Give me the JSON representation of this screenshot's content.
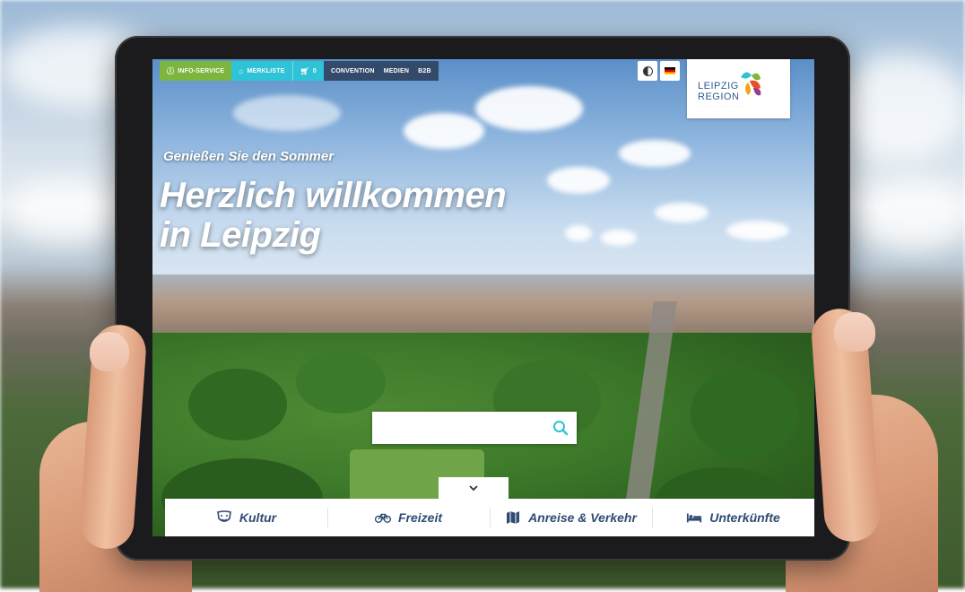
{
  "topnav": {
    "info_service": "INFO-SERVICE",
    "merkliste": "MERKLISTE",
    "cart_count": "0",
    "convention": "CONVENTION",
    "medien": "MEDIEN",
    "b2b": "B2B"
  },
  "logo": {
    "line1": "LEIPZIG",
    "line2": "REGION"
  },
  "hero": {
    "tagline": "Genießen Sie den Sommer",
    "headline_line1": "Herzlich willkommen",
    "headline_line2": "in Leipzig"
  },
  "search": {
    "placeholder": ""
  },
  "categories": [
    {
      "label": "Kultur",
      "icon": "theater-masks-icon"
    },
    {
      "label": "Freizeit",
      "icon": "bicycle-icon"
    },
    {
      "label": "Anreise & Verkehr",
      "icon": "map-icon"
    },
    {
      "label": "Unterkünfte",
      "icon": "bed-icon"
    }
  ],
  "colors": {
    "green": "#7db63f",
    "cyan": "#2ec3d6",
    "navy": "#344a6b",
    "category_text": "#2f4c73",
    "search_icon": "#2ec3d6"
  }
}
